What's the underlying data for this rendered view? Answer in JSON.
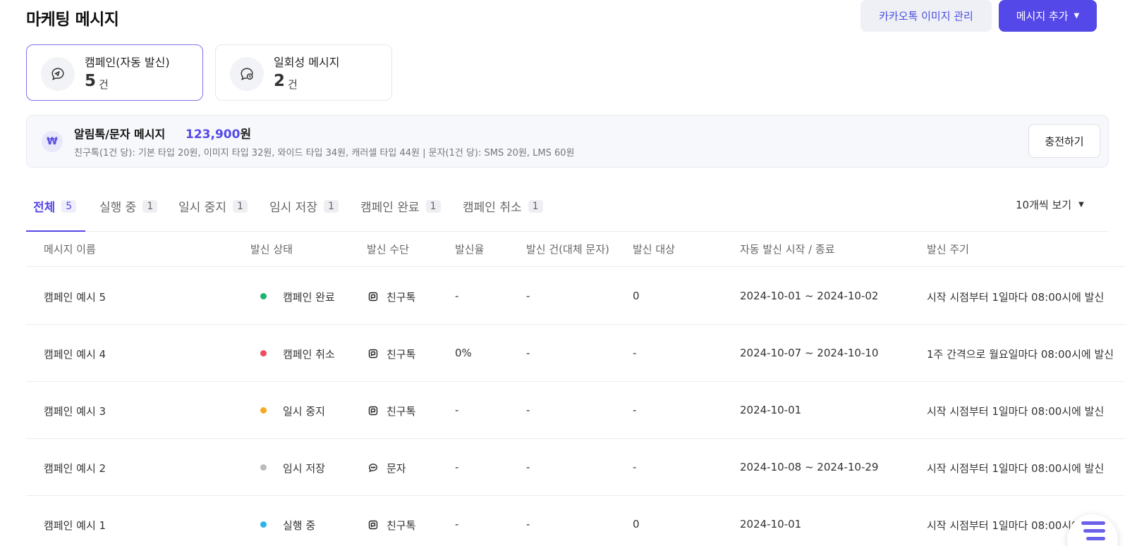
{
  "page": {
    "title": "마케팅 메시지"
  },
  "header": {
    "kakao_image_button": "카카오톡 이미지 관리",
    "add_message_button": "메시지 추가"
  },
  "cards": [
    {
      "label": "캠페인(자동 발신)",
      "count": "5",
      "unit": "건",
      "icon": "chat-send-icon"
    },
    {
      "label": "일회성 메시지",
      "count": "2",
      "unit": "건",
      "icon": "chat-clock-icon"
    }
  ],
  "banner": {
    "icon": "₩",
    "title": "알림톡/문자 메시지",
    "amount": "123,900",
    "amount_unit": "원",
    "description": "친구톡(1건 당): 기본 타입 20원, 이미지 타입 32원, 와이드 타입 34원, 캐러셀 타입 44원 | 문자(1건 당): SMS 20원, LMS 60원",
    "charge_button": "충전하기"
  },
  "tabs": [
    {
      "label": "전체",
      "count": "5"
    },
    {
      "label": "실행 중",
      "count": "1"
    },
    {
      "label": "일시 중지",
      "count": "1"
    },
    {
      "label": "임시 저장",
      "count": "1"
    },
    {
      "label": "캠페인 완료",
      "count": "1"
    },
    {
      "label": "캠페인 취소",
      "count": "1"
    }
  ],
  "per_page": "10개씩 보기",
  "table": {
    "columns": [
      "메시지 이름",
      "발신 상태",
      "발신 수단",
      "발신율",
      "발신 건(대체 문자)",
      "발신 대상",
      "자동 발신 시작 / 종료",
      "발신 주기"
    ],
    "rows": [
      {
        "name": "캠페인 예시 5",
        "status": "캠페인 완료",
        "status_color": "#1db46e",
        "channel": "친구톡",
        "channel_icon": "friendtalk-icon",
        "rate": "-",
        "sent": "-",
        "target": "0",
        "period": "2024-10-01 ~ 2024-10-02",
        "cycle": "시작 시점부터 1일마다 08:00시에 발신"
      },
      {
        "name": "캠페인 예시 4",
        "status": "캠페인 취소",
        "status_color": "#ee4d5f",
        "channel": "친구톡",
        "channel_icon": "friendtalk-icon",
        "rate": "0%",
        "sent": "-",
        "target": "-",
        "period": "2024-10-07 ~ 2024-10-10",
        "cycle": "1주 간격으로 월요일마다 08:00시에 발신"
      },
      {
        "name": "캠페인 예시 3",
        "status": "일시 중지",
        "status_color": "#f7a823",
        "channel": "친구톡",
        "channel_icon": "friendtalk-icon",
        "rate": "-",
        "sent": "-",
        "target": "-",
        "period": "2024-10-01",
        "cycle": "시작 시점부터 1일마다 08:00시에 발신"
      },
      {
        "name": "캠페인 예시 2",
        "status": "임시 저장",
        "status_color": "#bbbbbb",
        "channel": "문자",
        "channel_icon": "sms-bubble-icon",
        "rate": "-",
        "sent": "-",
        "target": "-",
        "period": "2024-10-08 ~ 2024-10-29",
        "cycle": "시작 시점부터 1일마다 08:00시에 발신"
      },
      {
        "name": "캠페인 예시 1",
        "status": "실행 중",
        "status_color": "#2eb3e8",
        "channel": "친구톡",
        "channel_icon": "friendtalk-icon",
        "rate": "-",
        "sent": "-",
        "target": "0",
        "period": "2024-10-01",
        "cycle": "시작 시점부터 1일마다 08:00시에 발신"
      }
    ]
  },
  "colors": {
    "accent": "#5448e8",
    "accent_light": "#efeefc",
    "border": "#ececf0"
  }
}
